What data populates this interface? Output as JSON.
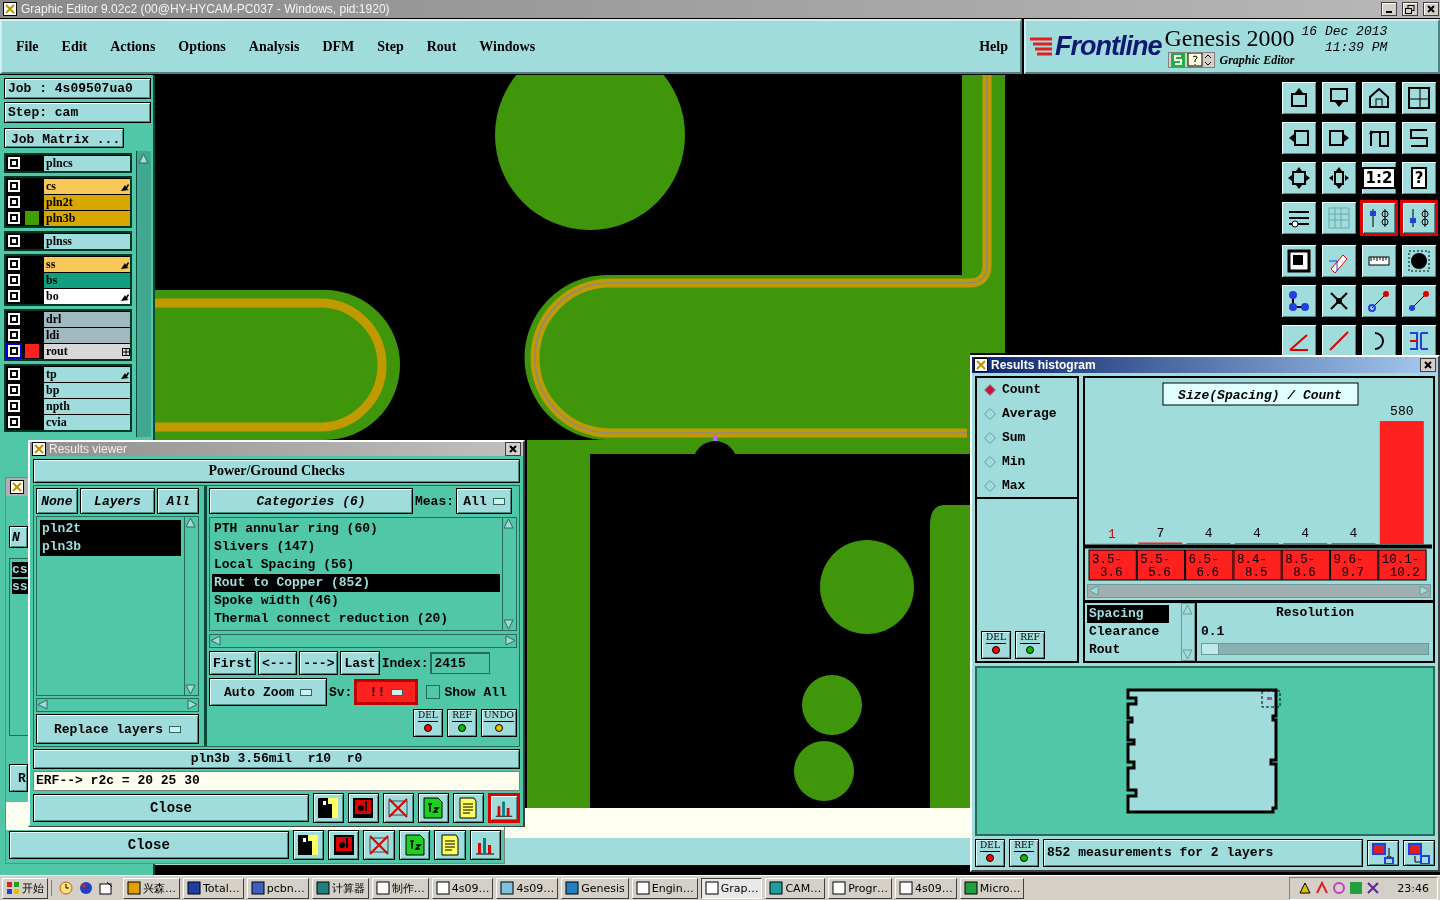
{
  "window": {
    "title": "Graphic Editor 9.02c2 (00@HY-HYCAM-PC037 - Windows, pid:1920)"
  },
  "menu": [
    "File",
    "Edit",
    "Actions",
    "Options",
    "Analysis",
    "DFM",
    "Step",
    "Rout",
    "Windows"
  ],
  "help": "Help",
  "brand": {
    "logo": "Frontline",
    "product": "Genesis 2000",
    "subtitle": "Graphic Editor",
    "date": "16 Dec 2013",
    "time": "11:39 PM"
  },
  "job": "Job : 4s09507ua0",
  "step": "Step: cam",
  "job_matrix": "Job Matrix ...",
  "layer_groups": [
    [
      {
        "name": "plncs",
        "color": "#a0dcdc",
        "pointer": false,
        "grid": false,
        "work": false
      }
    ],
    [
      {
        "name": "cs",
        "color": "#f8c858",
        "pointer": true,
        "grid": false,
        "work": false
      },
      {
        "name": "pln2t",
        "color": "#d8a800",
        "pointer": false,
        "grid": false,
        "work": false
      },
      {
        "name": "pln3b",
        "color": "#d8a800",
        "swatch": {
          "color": "#40a000"
        },
        "pointer": false,
        "grid": false,
        "work": false
      }
    ],
    [
      {
        "name": "plnss",
        "color": "#a0dcdc",
        "pointer": false,
        "grid": false,
        "work": false
      }
    ],
    [
      {
        "name": "ss",
        "color": "#f8c858",
        "pointer": true,
        "grid": false,
        "work": false
      },
      {
        "name": "bs",
        "color": "#10a080",
        "pointer": false,
        "grid": false,
        "work": false
      },
      {
        "name": "bo",
        "color": "#ffffff",
        "pointer": true,
        "grid": false,
        "work": false
      }
    ],
    [
      {
        "name": "drl",
        "color": "#a0b8c0",
        "pointer": false,
        "grid": false,
        "work": false
      },
      {
        "name": "ldi",
        "color": "#a0b8c0",
        "pointer": false,
        "grid": false,
        "work": false
      },
      {
        "name": "rout",
        "color": "#d8d8d8",
        "swatch": {
          "color": "#ff2020"
        },
        "pointer": false,
        "grid": true,
        "work": true
      }
    ],
    [
      {
        "name": "tp",
        "color": "#a0dcdc",
        "pointer": true,
        "grid": false,
        "work": false
      },
      {
        "name": "bp",
        "color": "#a0dcdc",
        "pointer": false,
        "grid": false,
        "work": false
      },
      {
        "name": "npth",
        "color": "#a0dcdc",
        "pointer": false,
        "grid": false,
        "work": false
      },
      {
        "name": "cvia",
        "color": "#a0dcdc",
        "pointer": false,
        "grid": false,
        "work": false
      }
    ]
  ],
  "toolbar": [
    {
      "selected": false
    },
    {
      "selected": false
    },
    {
      "selected": false
    },
    {
      "selected": false
    },
    {
      "selected": false
    },
    {
      "selected": false
    },
    {
      "selected": false
    },
    {
      "selected": false
    },
    {
      "selected": false
    },
    {
      "selected": false
    },
    {
      "selected": false,
      "label": "1:2"
    },
    {
      "selected": false,
      "label": "?"
    },
    {
      "selected": false
    },
    {
      "selected": false
    },
    {
      "selected": true
    },
    {
      "selected": true
    },
    {
      "selected": false
    },
    {
      "selected": false
    },
    {
      "selected": false
    },
    {
      "selected": false
    },
    {
      "selected": false
    },
    {
      "selected": false
    },
    {
      "selected": false
    },
    {
      "selected": false
    },
    {
      "selected": false
    },
    {
      "selected": false
    },
    {
      "selected": false
    },
    {
      "selected": false
    }
  ],
  "back_window": {
    "fragments": [
      "N",
      "cs",
      "ss",
      "R"
    ],
    "close": "Close",
    "tools": [
      {
        "selected": false
      },
      {
        "selected": false
      },
      {
        "selected": false
      },
      {
        "selected": false
      },
      {
        "selected": false
      },
      {
        "selected": false
      }
    ]
  },
  "results_viewer": {
    "title": "Results viewer",
    "header": "Power/Ground Checks",
    "layer_buttons": [
      "None",
      "Layers",
      "All"
    ],
    "layers": [
      {
        "name": "pln2t",
        "selected": true
      },
      {
        "name": "pln3b",
        "selected": true
      }
    ],
    "replace": "Replace layers",
    "categories_button": "Categories (6)",
    "meas_label": "Meas:",
    "meas_value": "All",
    "categories": [
      {
        "name": "PTH annular ring (60)",
        "selected": false
      },
      {
        "name": "Slivers (147)",
        "selected": false
      },
      {
        "name": "Local Spacing (56)",
        "selected": false
      },
      {
        "name": "Rout to Copper (852)",
        "selected": true
      },
      {
        "name": "Spoke width (46)",
        "selected": false
      },
      {
        "name": "Thermal connect reduction (20)",
        "selected": false
      }
    ],
    "nav": [
      "First",
      "<---",
      "--->",
      "Last"
    ],
    "index_label": "Index:",
    "index": "2415",
    "zoom": "Auto Zoom",
    "sv_label": "Sv:",
    "sv": "!!",
    "show_all": {
      "label": "Show All",
      "checked": false
    },
    "actions": [
      {
        "label": "DEL",
        "color": "#ff0000"
      },
      {
        "label": "REF",
        "color": "#00c000"
      },
      {
        "label": "UNDO",
        "color": "#e0c000"
      }
    ],
    "status": "pln3b 3.56mil  r10  r0",
    "erf": "ERF--> r2c = 20 25 30",
    "close": "Close",
    "tools": [
      {
        "selected": false
      },
      {
        "selected": false
      },
      {
        "selected": false
      },
      {
        "selected": false
      },
      {
        "selected": false
      },
      {
        "selected": true
      }
    ]
  },
  "histogram": {
    "title": "Results histogram",
    "modes": [
      {
        "label": "Count",
        "selected": true
      },
      {
        "label": "Average",
        "selected": false
      },
      {
        "label": "Sum",
        "selected": false
      },
      {
        "label": "Min",
        "selected": false
      },
      {
        "label": "Max",
        "selected": false
      }
    ],
    "actions": [
      {
        "label": "DEL",
        "color": "#ff0000"
      },
      {
        "label": "REF",
        "color": "#00c000"
      }
    ],
    "chart_data": {
      "type": "bar",
      "title": "Size(Spacing) / Count",
      "categories": [
        "3.5-3.6",
        "5.5-5.6",
        "6.5-6.6",
        "8.4-8.5",
        "8.5-8.6",
        "9.6-9.7",
        "10.1-10.2"
      ],
      "values": [
        1,
        7,
        4,
        4,
        4,
        4,
        580
      ],
      "data_labels": true
    },
    "measures": [
      {
        "label": "Spacing",
        "selected": true
      },
      {
        "label": "Clearance",
        "selected": false
      },
      {
        "label": "Rout",
        "selected": false
      }
    ],
    "resolution_label": "Resolution",
    "resolution": "0.1",
    "resolution_slider": {
      "level": 0.07
    },
    "bottom_actions": [
      {
        "label": "DEL",
        "color": "#ff0000"
      },
      {
        "label": "REF",
        "color": "#00c000"
      }
    ],
    "status": "852 measurements for 2 layers"
  },
  "taskbar": {
    "start": "开始",
    "tasks": [
      {
        "label": "兴森…",
        "selected": false
      },
      {
        "label": "Total…",
        "selected": false
      },
      {
        "label": "pcbn…",
        "selected": false
      },
      {
        "label": "计算器",
        "selected": false
      },
      {
        "label": "制作…",
        "selected": false
      },
      {
        "label": "4s09…",
        "selected": false
      },
      {
        "label": "4s09…",
        "selected": false
      },
      {
        "label": "Genesis",
        "selected": false
      },
      {
        "label": "Engin…",
        "selected": false
      },
      {
        "label": "Grap…",
        "selected": true
      },
      {
        "label": "CAM…",
        "selected": false
      },
      {
        "label": "Progr…",
        "selected": false
      },
      {
        "label": "4s09…",
        "selected": false
      },
      {
        "label": "Micro…",
        "selected": false
      }
    ],
    "clock": "23:46"
  }
}
